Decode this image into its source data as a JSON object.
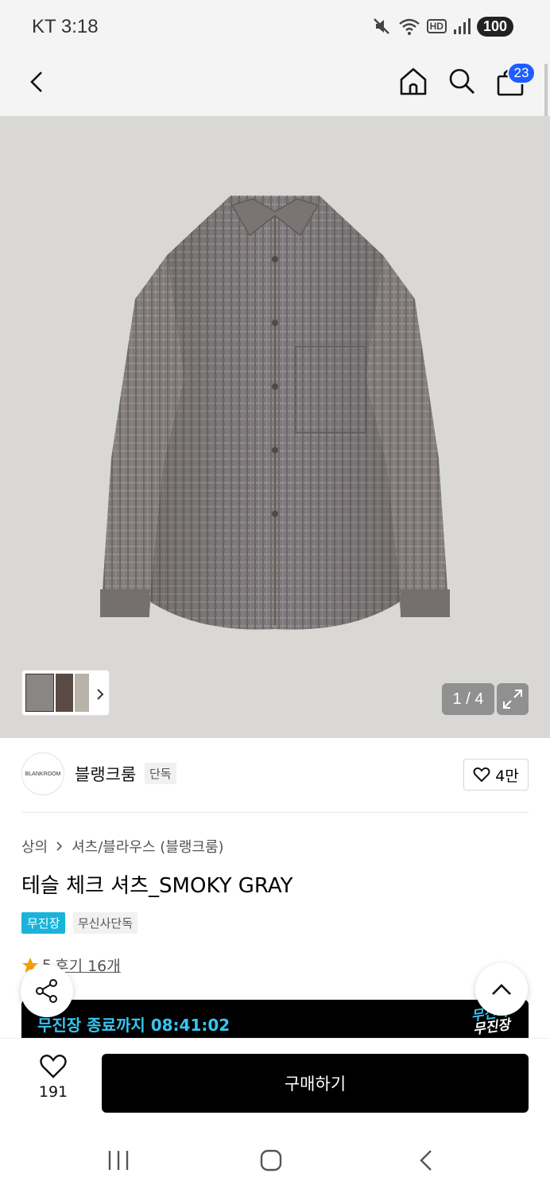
{
  "status_bar": {
    "carrier_time": "KT 3:18",
    "battery": "100",
    "hd": "HD",
    "icons": [
      "mute-icon",
      "wifi-icon",
      "hd-icon",
      "signal-icon",
      "battery-icon"
    ]
  },
  "top_bar": {
    "icons": [
      "back-icon",
      "home-icon",
      "search-icon",
      "cart-icon"
    ],
    "cart_count": "23"
  },
  "gallery": {
    "counter": "1 / 4",
    "icons": [
      "chevron-right-icon",
      "expand-icon"
    ]
  },
  "brand": {
    "logo_text": "BLANKROOM",
    "name": "블랭크룸",
    "tag": "단독",
    "like_count": "4만"
  },
  "breadcrumb": {
    "category": "상의",
    "subcategory": "셔츠/블라우스 (블랭크룸)"
  },
  "product": {
    "title": "테슬 체크 셔츠_SMOKY GRAY",
    "tag_primary": "무진장",
    "tag_secondary": "무신사단독",
    "rating": "5",
    "review_link": "후기 16개"
  },
  "banner": {
    "text": "무진장 종료까지 08:41:02",
    "logo_line1": "무신사",
    "logo_line2": "무진장"
  },
  "bottom": {
    "wish_count": "191",
    "buy_label": "구매하기"
  },
  "colors": {
    "accent_blue": "#1e5eff",
    "tag_cyan": "#19b4d9",
    "banner_text": "#37c6f2"
  }
}
